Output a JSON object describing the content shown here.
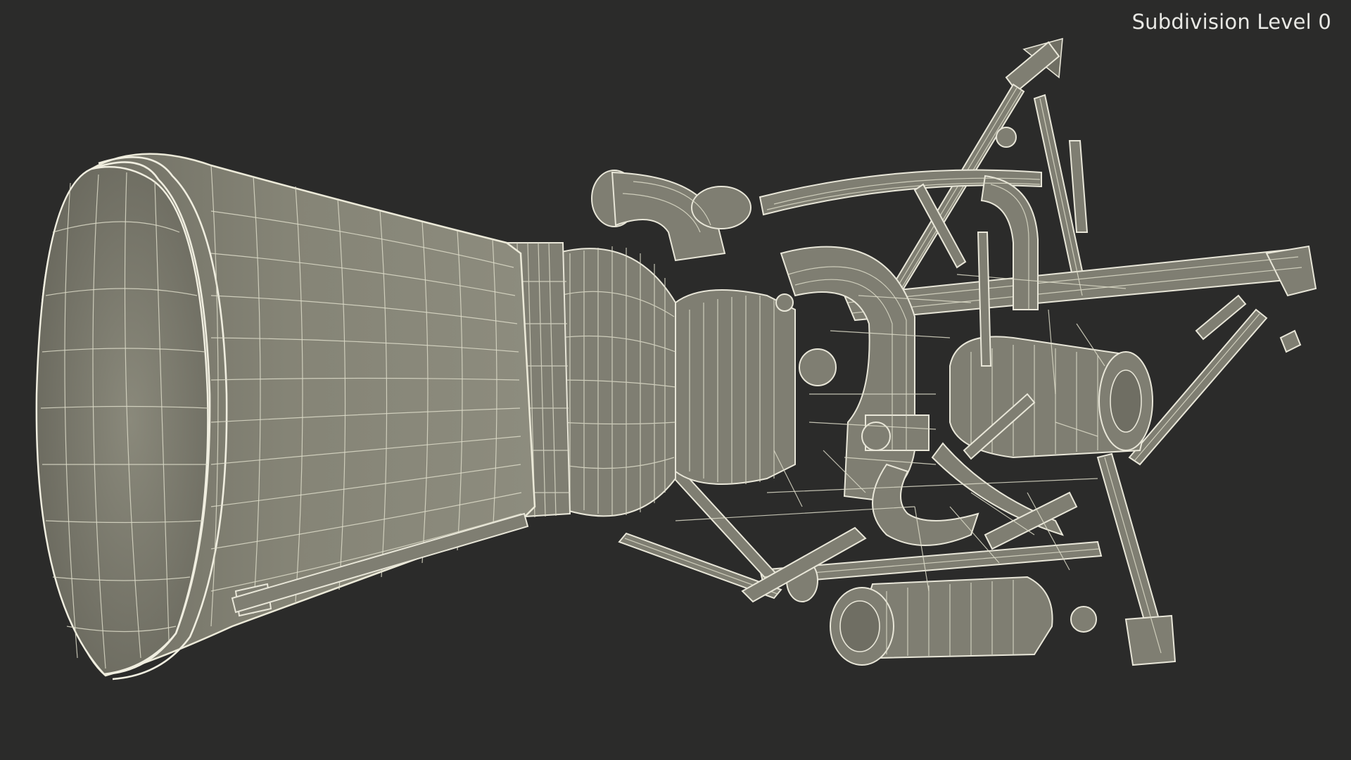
{
  "viewport": {
    "subdivision_label": "Subdivision Level 0",
    "background_color": "#2b2b2a",
    "model_color": "#7f7e72",
    "wire_color": "#e6e4d6"
  },
  "model": {
    "subject": "rocket-engine-wireframe"
  }
}
